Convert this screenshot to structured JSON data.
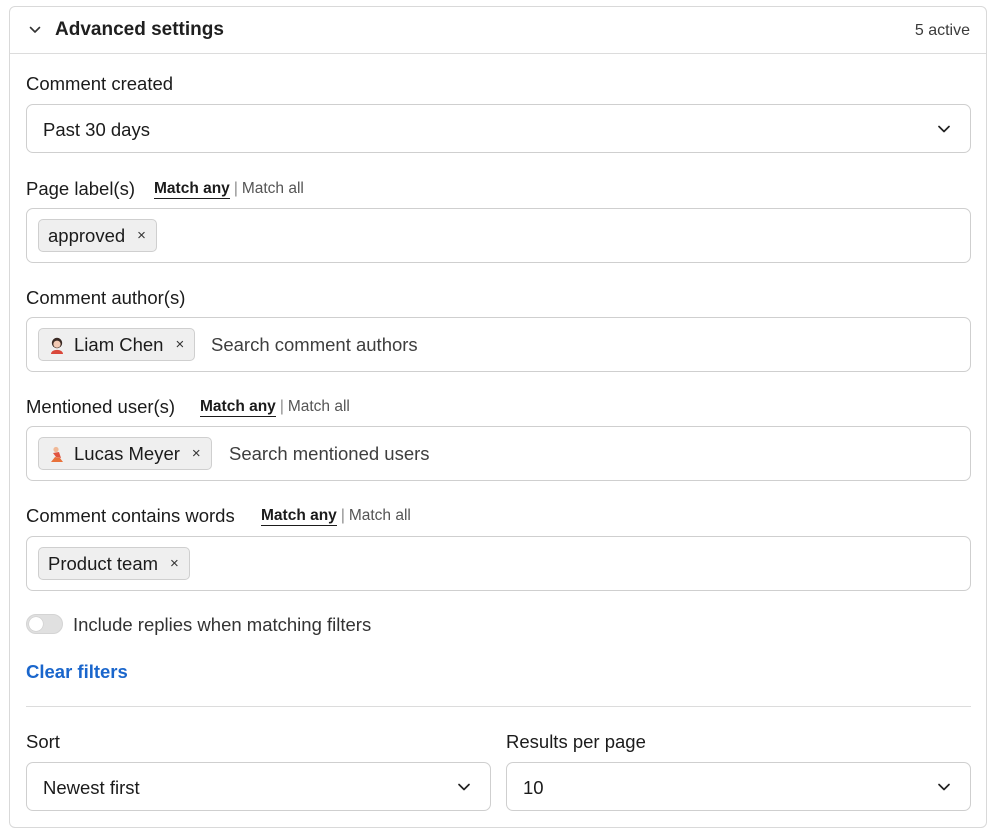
{
  "header": {
    "title": "Advanced settings",
    "active_count": "5 active",
    "icon": "chevron-down-icon"
  },
  "comment_created": {
    "label": "Comment created",
    "value": "Past 30 days"
  },
  "page_labels": {
    "label": "Page label(s)",
    "match_any": "Match any",
    "separator": "|",
    "match_all": "Match all",
    "selected_match": "Match any",
    "chips": [
      {
        "label": "approved",
        "remove": "×"
      }
    ]
  },
  "comment_authors": {
    "label": "Comment author(s)",
    "chips": [
      {
        "label": "Liam Chen",
        "remove": "×",
        "avatar": "avatar-icon"
      }
    ],
    "placeholder": "Search comment authors"
  },
  "mentioned_users": {
    "label": "Mentioned user(s)",
    "match_any": "Match any",
    "separator": "|",
    "match_all": "Match all",
    "selected_match": "Match any",
    "chips": [
      {
        "label": "Lucas Meyer",
        "remove": "×",
        "avatar": "avatar-icon"
      }
    ],
    "placeholder": "Search mentioned users"
  },
  "contains_words": {
    "label": "Comment contains words",
    "match_any": "Match any",
    "separator": "|",
    "match_all": "Match all",
    "selected_match": "Match any",
    "chips": [
      {
        "label": "Product team",
        "remove": "×"
      }
    ]
  },
  "include_replies": {
    "label": "Include replies when matching filters",
    "enabled": false
  },
  "clear_filters": "Clear filters",
  "sort": {
    "label": "Sort",
    "value": "Newest first"
  },
  "results_per_page": {
    "label": "Results per page",
    "value": "10"
  },
  "colors": {
    "link": "#1a66cc",
    "border": "#cfcfcf",
    "chip_bg": "#efefef"
  }
}
